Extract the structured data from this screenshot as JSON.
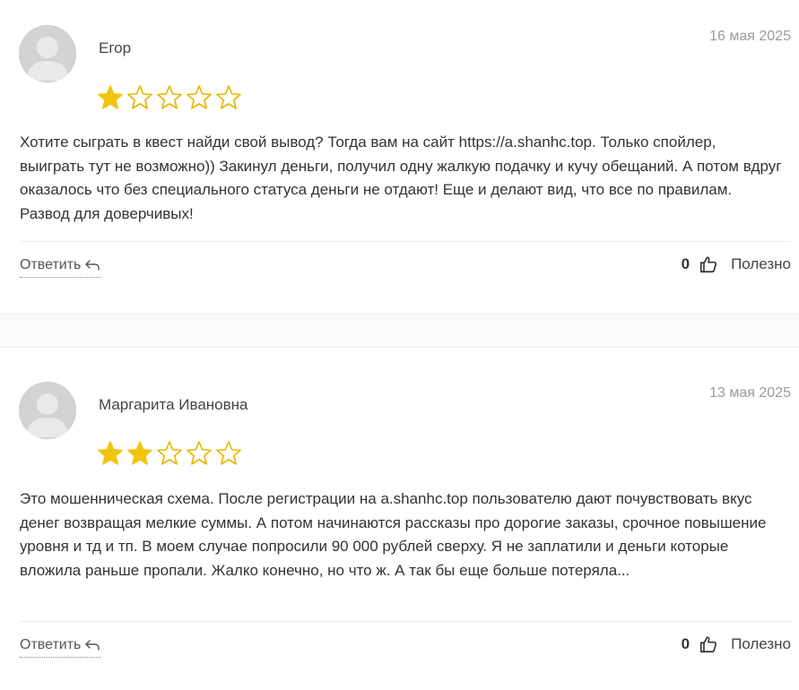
{
  "colors": {
    "star_filled": "#f1c40f",
    "star_outline": "#e8b600",
    "date": "#9a9a9a",
    "avatar_bg": "#d3d3d3"
  },
  "reviews": [
    {
      "author": "Егор",
      "date": "16 мая 2025",
      "rating": 1,
      "rating_max": 5,
      "text": "Хотите сыграть в квест найди свой вывод? Тогда вам на сайт https://a.shanhc.top. Только спойлер, выиграть тут не возможно)) Закинул деньги, получил одну жалкую подачку и кучу обещаний. А потом вдруг оказалось что без специального статуса деньги не отдают! Еще и делают вид, что все по правилам. Развод для доверчивых!",
      "reply_label": "Ответить",
      "helpful_count": "0",
      "helpful_label": "Полезно"
    },
    {
      "author": "Маргарита Ивановна",
      "date": "13 мая 2025",
      "rating": 2,
      "rating_max": 5,
      "text": "Это мошенническая схема. После регистрации на a.shanhc.top пользователю дают почувствовать вкус денег возвращая мелкие суммы. А потом начинаются рассказы про дорогие заказы, срочное повышение уровня и тд и тп. В моем случае попросили 90 000 рублей сверху. Я не заплатили и деньги которые вложила раньше пропали. Жалко конечно, но что ж. А так бы еще больше потеряла...",
      "reply_label": "Ответить",
      "helpful_count": "0",
      "helpful_label": "Полезно"
    }
  ]
}
